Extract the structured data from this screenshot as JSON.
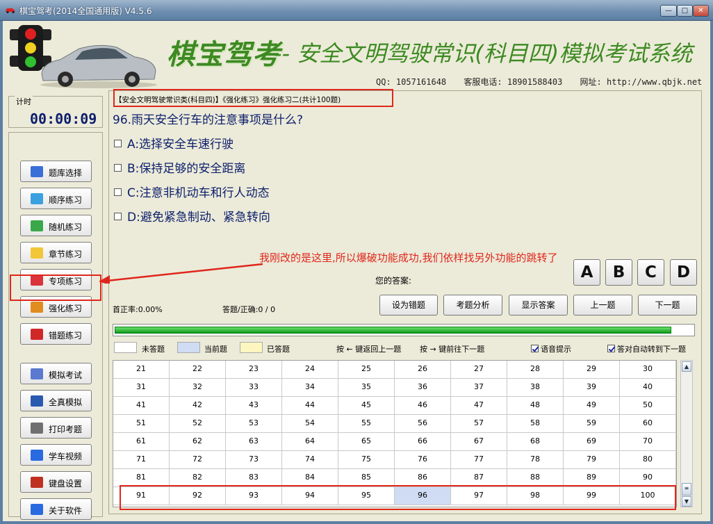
{
  "window": {
    "title": "棋宝驾考(2014全国通用版) V4.5.6",
    "min_label": "—",
    "max_label": "□",
    "close_label": "✕"
  },
  "header": {
    "brand": "棋宝驾考",
    "subtitle": "-- 安全文明驾驶常识(科目四)模拟考试系统",
    "qq": "QQ: 1057161648",
    "phone": "客服电话: 18901588403",
    "website": "网址: http://www.qbjk.net"
  },
  "timer": {
    "label": "计时",
    "value": "00:00:09"
  },
  "menu": [
    {
      "label": "题库选择",
      "icon": "cubes-icon",
      "color": "#3a6fd8"
    },
    {
      "label": "顺序练习",
      "icon": "pencil-icon",
      "color": "#3aa0e0"
    },
    {
      "label": "随机练习",
      "icon": "refresh-icon",
      "color": "#3aa84a"
    },
    {
      "label": "章节练习",
      "icon": "note-icon",
      "color": "#f2c638"
    },
    {
      "label": "专项练习",
      "icon": "check-icon",
      "color": "#d8343a"
    },
    {
      "label": "强化练习",
      "icon": "bar-chart-icon",
      "color": "#e08c1e"
    },
    {
      "label": "错题练习",
      "icon": "flag-icon",
      "color": "#d02828"
    },
    {
      "label": "模拟考试",
      "icon": "calendar-icon",
      "color": "#5a7ad0"
    },
    {
      "label": "全真模拟",
      "icon": "grid-icon",
      "color": "#2a5ab0"
    },
    {
      "label": "打印考题",
      "icon": "printer-icon",
      "color": "#707070"
    },
    {
      "label": "学车视频",
      "icon": "video-icon",
      "color": "#2a6ae0"
    },
    {
      "label": "键盘设置",
      "icon": "wrench-icon",
      "color": "#c03020"
    },
    {
      "label": "关于软件",
      "icon": "info-icon",
      "color": "#2a6ae0"
    }
  ],
  "breadcrumb": "【安全文明驾驶常识类(科目四)】《强化练习》强化练习二(共计100题)",
  "question": {
    "text": "96.雨天安全行车的注意事项是什么?",
    "options": [
      "A:选择安全车速行驶",
      "B:保持足够的安全距离",
      "C:注意非机动车和行人动态",
      "D:避免紧急制动、紧急转向"
    ]
  },
  "annotation": "我刚改的是这里,所以爆破功能成功,我们依样找另外功能的跳转了",
  "answer": {
    "label": "您的答案:",
    "buttons": [
      "A",
      "B",
      "C",
      "D"
    ]
  },
  "stats": {
    "first_accuracy": "首正率:0.00%",
    "answered": "答题/正确:0 / 0"
  },
  "actions": [
    "设为错题",
    "考题分析",
    "显示答案",
    "上一题",
    "下一题"
  ],
  "progress": 0.96,
  "legend": {
    "unanswered": "未答题",
    "current": "当前题",
    "answered": "已答题",
    "colors": {
      "unanswered": "#ffffff",
      "current": "#cfdcf4",
      "answered": "#fdf6c0"
    }
  },
  "hints": {
    "prev": "按 ← 键返回上一题",
    "next": "按 → 键前往下一题"
  },
  "options_checks": {
    "voice": "语音提示",
    "auto_next": "答对自动转到下一题"
  },
  "grid": {
    "rows": [
      [
        "21",
        "22",
        "23",
        "24",
        "25",
        "26",
        "27",
        "28",
        "29",
        "30"
      ],
      [
        "31",
        "32",
        "33",
        "34",
        "35",
        "36",
        "37",
        "38",
        "39",
        "40"
      ],
      [
        "41",
        "42",
        "43",
        "44",
        "45",
        "46",
        "47",
        "48",
        "49",
        "50"
      ],
      [
        "51",
        "52",
        "53",
        "54",
        "55",
        "56",
        "57",
        "58",
        "59",
        "60"
      ],
      [
        "61",
        "62",
        "63",
        "64",
        "65",
        "66",
        "67",
        "68",
        "69",
        "70"
      ],
      [
        "71",
        "72",
        "73",
        "74",
        "75",
        "76",
        "77",
        "78",
        "79",
        "80"
      ],
      [
        "81",
        "82",
        "83",
        "84",
        "85",
        "86",
        "87",
        "88",
        "89",
        "90"
      ],
      [
        "91",
        "92",
        "93",
        "94",
        "95",
        "96",
        "97",
        "98",
        "99",
        "100"
      ]
    ],
    "current": "96"
  },
  "accent": {
    "annotation_red": "#e0261c",
    "brand_green": "#3d8a22",
    "question_blue": "#0c1e6c"
  }
}
